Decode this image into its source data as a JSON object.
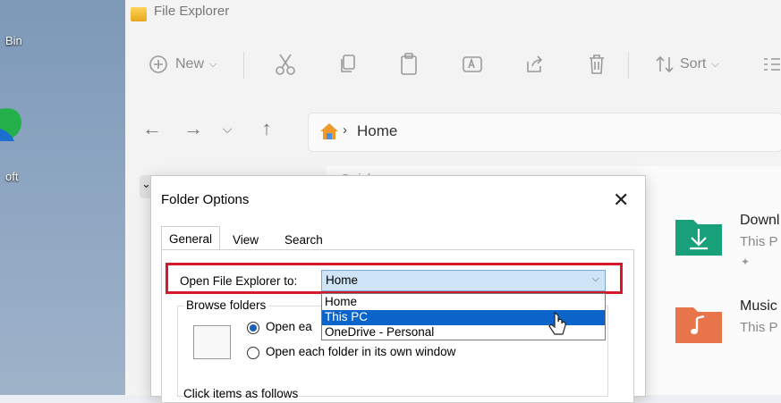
{
  "desktop": {
    "labels": [
      "Bin",
      "oft"
    ]
  },
  "window": {
    "title": "File Explorer"
  },
  "toolbar": {
    "new_label": "New",
    "sort_label": "Sort",
    "icons": [
      "cut-icon",
      "copy-icon",
      "paste-icon",
      "rename-icon",
      "share-icon",
      "delete-icon"
    ]
  },
  "address": {
    "location": "Home",
    "separator": "›"
  },
  "content": {
    "section_title": "Quick access",
    "tiles": [
      {
        "name": "Downl",
        "sub": "This P",
        "color": "#18a07a"
      },
      {
        "name": "Music",
        "sub": "This P",
        "color": "#e8744a"
      }
    ]
  },
  "dialog": {
    "title": "Folder Options",
    "tabs": [
      "General",
      "View",
      "Search"
    ],
    "open_label": "Open File Explorer to:",
    "open_value": "Home",
    "options": [
      "Home",
      "This PC",
      "OneDrive - Personal"
    ],
    "selected_option_index": 1,
    "browse_group": "Browse folders",
    "radio_1": "Open each folder in the same window",
    "radio_1_visible": "Open ea",
    "radio_2": "Open each folder in its own window",
    "click_items": "Click items as follows"
  },
  "colors": {
    "highlight_box": "#d4192c",
    "selection": "#0a64c9",
    "combo_bg": "#cfe4f7"
  }
}
